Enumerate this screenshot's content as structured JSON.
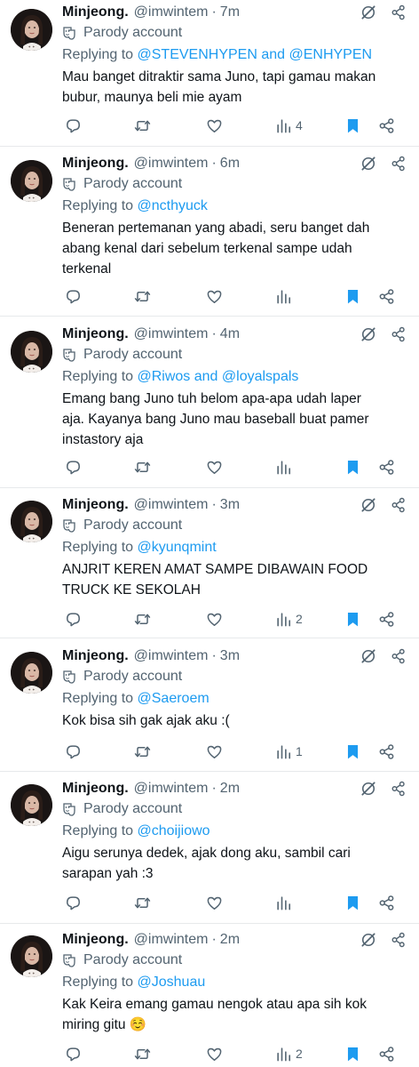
{
  "posts": [
    {
      "display_name": "Minjeong.",
      "handle": "@imwintem",
      "separator": "·",
      "time": "7m",
      "parody_label": "Parody account",
      "replying_prefix": "Replying to ",
      "replying_to": "@STEVENHYPEN and @ENHYPEN",
      "lines": [
        "Mau banget ditraktir sama Juno, tapi gamau makan",
        "bubur, maunya beli mie ayam"
      ],
      "views": "4"
    },
    {
      "display_name": "Minjeong.",
      "handle": "@imwintem",
      "separator": "·",
      "time": "6m",
      "parody_label": "Parody account",
      "replying_prefix": "Replying to ",
      "replying_to": "@ncthyuck",
      "lines": [
        "Beneran pertemanan yang abadi, seru banget dah",
        "abang kenal dari sebelum terkenal sampe udah",
        "terkenal"
      ],
      "views": ""
    },
    {
      "display_name": "Minjeong.",
      "handle": "@imwintem",
      "separator": "·",
      "time": "4m",
      "parody_label": "Parody account",
      "replying_prefix": "Replying to ",
      "replying_to": "@Riwos and @loyalspals",
      "lines": [
        "Emang bang Juno tuh belom apa-apa udah laper",
        "aja. Kayanya bang Juno mau baseball buat pamer",
        "instastory aja"
      ],
      "views": ""
    },
    {
      "display_name": "Minjeong.",
      "handle": "@imwintem",
      "separator": "·",
      "time": "3m",
      "parody_label": "Parody account",
      "replying_prefix": "Replying to ",
      "replying_to": "@kyunqmint",
      "lines": [
        "ANJRIT KEREN AMAT SAMPE DIBAWAIN FOOD",
        "TRUCK KE SEKOLAH"
      ],
      "views": "2"
    },
    {
      "display_name": "Minjeong.",
      "handle": "@imwintem",
      "separator": "·",
      "time": "3m",
      "parody_label": "Parody account",
      "replying_prefix": "Replying to ",
      "replying_to": "@Saeroem",
      "lines": [
        "Kok bisa sih gak ajak aku :("
      ],
      "views": "1"
    },
    {
      "display_name": "Minjeong.",
      "handle": "@imwintem",
      "separator": "·",
      "time": "2m",
      "parody_label": "Parody account",
      "replying_prefix": "Replying to ",
      "replying_to": "@choijiowo",
      "lines": [
        "Aigu serunya dedek, ajak dong aku, sambil cari",
        "sarapan yah :3"
      ],
      "views": ""
    },
    {
      "display_name": "Minjeong.",
      "handle": "@imwintem",
      "separator": "·",
      "time": "2m",
      "parody_label": "Parody account",
      "replying_prefix": "Replying to ",
      "replying_to": "@Joshuau",
      "lines": [
        "Kak Keira emang gamau nengok atau apa sih kok",
        "miring gitu ☺️"
      ],
      "views": "2"
    }
  ],
  "colors": {
    "accent": "#1d9bf0",
    "secondary_text": "#536471",
    "primary_text": "#0f1419",
    "divider": "#e7e9eb"
  },
  "icons": {
    "grok": "grok-slash-circle-icon",
    "more": "share-nodes-icon",
    "reply": "reply-bubble-icon",
    "repost": "repost-arrows-icon",
    "like": "heart-icon",
    "views": "views-bars-icon",
    "bookmark": "bookmark-icon",
    "share": "share-icon",
    "parody": "theater-mask-icon"
  }
}
